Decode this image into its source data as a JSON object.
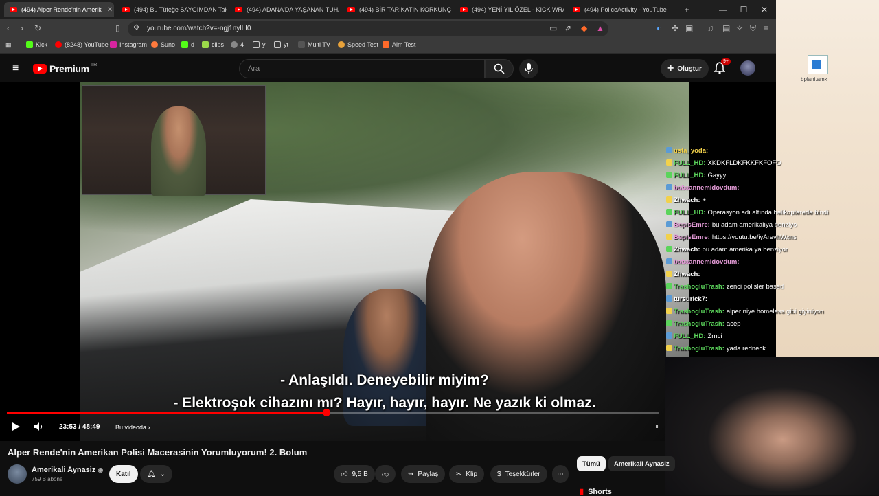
{
  "tabs": [
    {
      "label": "(494) Alper Rende'nin Amerik",
      "active": true
    },
    {
      "label": "(494) Bu Tüfeğe SAYGIMDAN Takım"
    },
    {
      "label": "(494) ADANA'DA YAŞANAN TUHAF O"
    },
    {
      "label": "(494) BİR TARİKATIN KORKUNÇ SON"
    },
    {
      "label": "(494) YENİ YIL ÖZEL - KICK WRAPPED"
    },
    {
      "label": "(494) PoliceActivity - YouTube"
    }
  ],
  "url": "youtube.com/watch?v=-ngj1nylLI0",
  "bookmarks": [
    "Kick",
    "(8248) YouTube",
    "Instagram",
    "Suno",
    "d",
    "clips",
    "4",
    "y",
    "yt",
    "Multi TV",
    "Speed Test",
    "Aim Test"
  ],
  "header": {
    "logo": "Premium",
    "logo_sup": "TR",
    "search_placeholder": "Ara",
    "create_label": "Oluştur",
    "notif_count": "9+"
  },
  "video": {
    "subtitle_line1": "- Anlaşıldı. Deneyebilir miyim?",
    "subtitle_line2": "- Elektroşok cihazını mı? Hayır, hayır, hayır. Ne yazık ki olmaz.",
    "time": "23:53 / 48:49",
    "chapter": "Bu videoda",
    "progress": 0.489
  },
  "chat": [
    {
      "user": "usta_yoda:",
      "msg": "",
      "color": "#f2d14b"
    },
    {
      "user": "FULL_HD:",
      "msg": "XKDKFLDKFKKFKFOFO",
      "color": "#5bd45b"
    },
    {
      "user": "FULL_HD:",
      "msg": "Gayyy",
      "color": "#5bd45b"
    },
    {
      "user": "babaannemidovdum:",
      "msg": "",
      "color": "#e39ad6"
    },
    {
      "user": "Zhwach:",
      "msg": "+",
      "color": "#ffffff"
    },
    {
      "user": "FULL_HD:",
      "msg": "Operasyon adı altında helikopterede bindi",
      "color": "#5bd45b"
    },
    {
      "user": "BepisEmre:",
      "msg": "bu adam amerikalıya benziyo",
      "color": "#e39ad6"
    },
    {
      "user": "BepisEmre:",
      "msg": "https://youtu.be/iyArevhWxns",
      "color": "#e39ad6"
    },
    {
      "user": "Zhwach:",
      "msg": "bu adam amerika ya benziyor",
      "color": "#ffffff"
    },
    {
      "user": "babaannemidovdum:",
      "msg": "",
      "color": "#e39ad6"
    },
    {
      "user": "Zhwach:",
      "msg": "",
      "color": "#ffffff"
    },
    {
      "user": "TrashogluTrash:",
      "msg": "zenci polisler based",
      "color": "#5bd45b"
    },
    {
      "user": "tursurick7:",
      "msg": "",
      "color": "#ffffff"
    },
    {
      "user": "TrashogluTrash:",
      "msg": "alper niye homeless gibi giyiniyon",
      "color": "#5bd45b"
    },
    {
      "user": "TrashogluTrash:",
      "msg": "acep",
      "color": "#5bd45b"
    },
    {
      "user": "FULL_HD:",
      "msg": "Zrnci",
      "color": "#5bd45b"
    },
    {
      "user": "TrashogluTrash:",
      "msg": "yada redneck",
      "color": "#5bd45b"
    }
  ],
  "desktop_file": "bplani.amk",
  "below": {
    "title": "Alper Rende'nin Amerikan Polisi Macerasinin Yorumluyorum! 2. Bolum",
    "channel": "Amerikali Aynasiz",
    "subs": "759 B abone",
    "join": "Katıl",
    "likes": "9,5 B",
    "share": "Paylaş",
    "clip": "Klip",
    "thanks": "Teşekkürler",
    "chip_all": "Tümü",
    "chip_channel": "Amerikali Aynasiz",
    "shorts": "Shorts"
  }
}
